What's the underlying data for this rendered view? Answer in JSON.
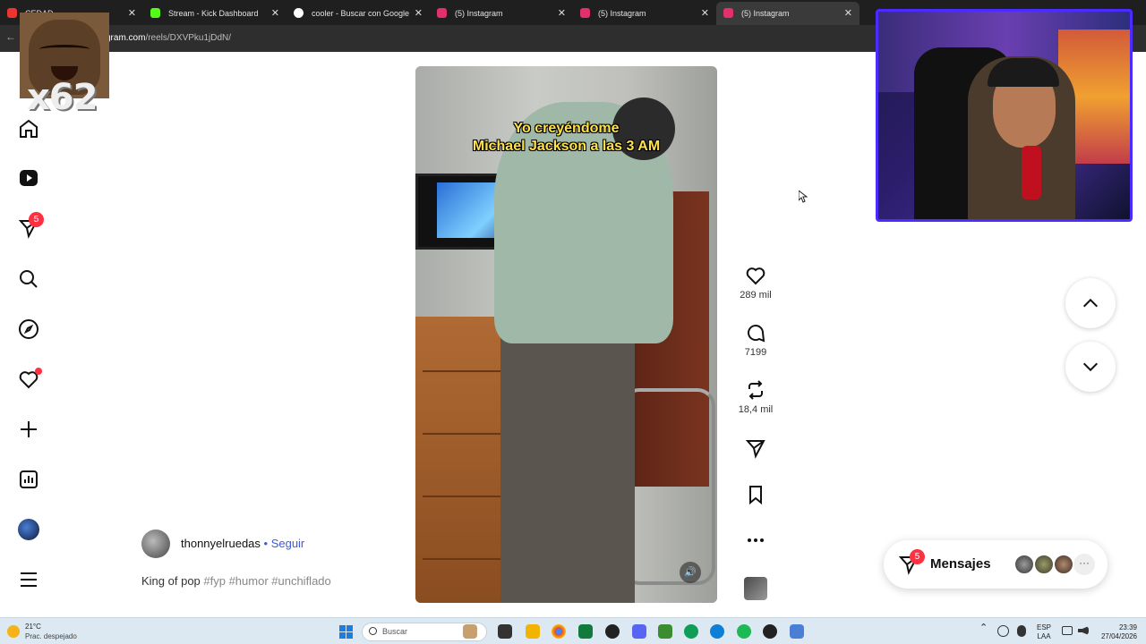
{
  "browser": {
    "tabs": [
      {
        "title": "CEDAD",
        "favicon_color": "#e33"
      },
      {
        "title": "Stream - Kick Dashboard",
        "favicon_color": "#53fc18"
      },
      {
        "title": "cooler - Buscar con Google",
        "favicon_color": "#fff"
      },
      {
        "title": "(5) Instagram",
        "favicon_color": "#e1306c"
      },
      {
        "title": "(5) Instagram",
        "favicon_color": "#e1306c"
      },
      {
        "title": "(5) Instagram",
        "favicon_color": "#e1306c"
      }
    ],
    "active_tab": 5,
    "url_domain": "gram.com",
    "url_path": "/reels/DXVPku1jDdN/"
  },
  "overlay": {
    "multiplier": "x62"
  },
  "nav": {
    "notifications_badge": "5"
  },
  "reel": {
    "caption_line1": "Yo creyéndome",
    "caption_line2": "Michael Jackson a las 3 AM",
    "likes": "289 mil",
    "comments": "7199",
    "reposts": "18,4 mil",
    "author": "thonnyelruedas",
    "separator": " • ",
    "follow_label": "Seguir",
    "description_text": "King of pop ",
    "hashtags": "#fyp #humor #unchiflado"
  },
  "messages": {
    "label": "Mensajes",
    "badge": "5",
    "more": "···"
  },
  "taskbar": {
    "temperature": "21°C",
    "condition": "Prac. despejado",
    "search_placeholder": "Buscar",
    "lang1": "ESP",
    "lang2": "LAA",
    "time": "23:39",
    "date": "27/04/2026"
  }
}
